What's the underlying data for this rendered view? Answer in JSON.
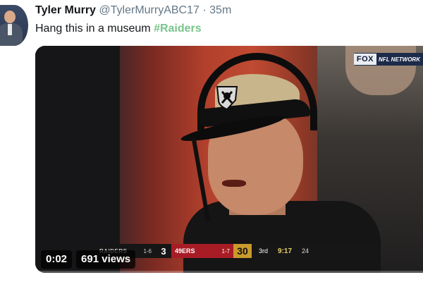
{
  "tweet": {
    "display_name": "Tyler Murry",
    "handle": "@TylerMurryABC17",
    "separator": "·",
    "timestamp": "35m",
    "text": "Hang this in a museum ",
    "hashtag": "#Raiders",
    "hashtag_color": "#79c48b"
  },
  "video": {
    "elapsed": "0:02",
    "views": "691 views",
    "progress": 0.01,
    "network_logo": "FOX",
    "network_secondary": "NFL NETWORK"
  },
  "scorebug": {
    "team1_abbr": "RAIDERS",
    "team1_record": "1-6",
    "team1_score": "3",
    "team2_abbr": "49ERS",
    "team2_record": "1-7",
    "team2_score": "30",
    "quarter": "3rd",
    "clock": "9:17",
    "play_clock": "24",
    "team2_color": "#a81c25",
    "accent_color": "#c99a2c"
  }
}
